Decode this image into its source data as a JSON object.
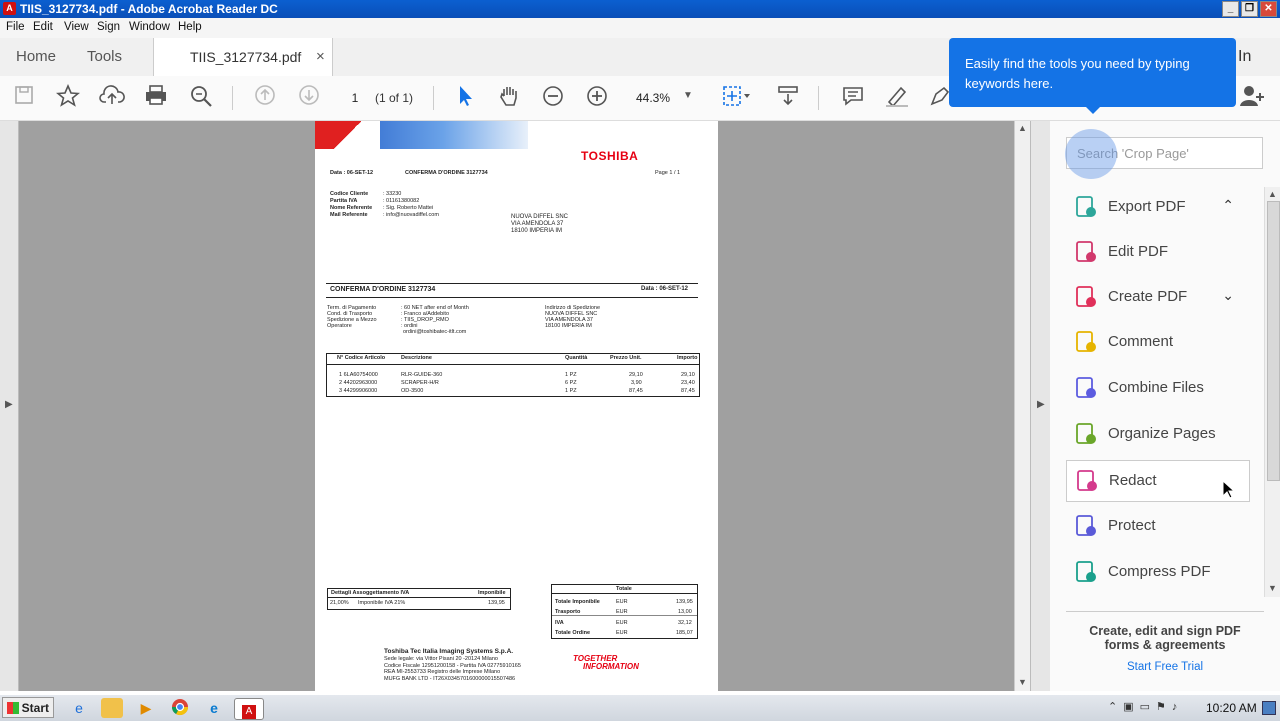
{
  "window": {
    "title": "TIIS_3127734.pdf - Adobe Acrobat Reader DC",
    "btn_min": "_",
    "btn_restore": "❐",
    "btn_close": "✕"
  },
  "menu": [
    "File",
    "Edit",
    "View",
    "Sign",
    "Window",
    "Help"
  ],
  "tabs": {
    "home": "Home",
    "tools": "Tools",
    "doc": "TIIS_3127734.pdf",
    "close": "×",
    "signin": "In"
  },
  "toolbar": {
    "page_value": "1",
    "page_of": "(1 of 1)",
    "zoom": "44.3%"
  },
  "callout": {
    "text": "Easily find the tools you need by typing keywords here."
  },
  "panel": {
    "search_placeholder": "Search 'Crop Page'",
    "tools": [
      {
        "label": "Export PDF",
        "icon": "export-pdf-icon",
        "color": "#2da69a",
        "chevron": "⌃"
      },
      {
        "label": "Edit PDF",
        "icon": "edit-pdf-icon",
        "color": "#d1386c",
        "chevron": ""
      },
      {
        "label": "Create PDF",
        "icon": "create-pdf-icon",
        "color": "#e0305a",
        "chevron": "⌄"
      },
      {
        "label": "Comment",
        "icon": "comment-icon",
        "color": "#e6b400",
        "chevron": ""
      },
      {
        "label": "Combine Files",
        "icon": "combine-files-icon",
        "color": "#5c5ce0",
        "chevron": ""
      },
      {
        "label": "Organize Pages",
        "icon": "organize-pages-icon",
        "color": "#6aa62a",
        "chevron": ""
      },
      {
        "label": "Redact",
        "icon": "redact-icon",
        "color": "#d43a8c",
        "chevron": ""
      },
      {
        "label": "Protect",
        "icon": "protect-icon",
        "color": "#5a5ad8",
        "chevron": ""
      },
      {
        "label": "Compress PDF",
        "icon": "compress-pdf-icon",
        "color": "#1aa08c",
        "chevron": ""
      }
    ],
    "promo_line1": "Create, edit and sign PDF",
    "promo_line2": "forms & agreements",
    "promo_link": "Start Free Trial"
  },
  "document": {
    "brand": "TOSHIBA",
    "date_small": "Data : 06-SET-12",
    "header_small": "CONFERMA D'ORDINE 3127734",
    "page_small": "Page  1 / 1",
    "client_labels": [
      "Codice Cliente",
      "Partita IVA",
      "Nome Referente",
      "Mail Referente"
    ],
    "client_values": [
      ": 33230",
      ": 01161380082",
      ": Sig. Roberto Mattei",
      ": info@nuovadiffel.com"
    ],
    "address": [
      "NUOVA DIFFEL SNC",
      "VIA AMENDOLA 37",
      "18100 IMPERIA IM"
    ],
    "title": "CONFERMA D'ORDINE 3127734",
    "title_date": "Data : 06-SET-12",
    "terms_labels": [
      "Term. di Pagamento",
      "Cond. di Trasporto",
      "Spedizione a Mezzo",
      "Operatore"
    ],
    "terms_values": [
      ": 60 NET after end of Month",
      ": Franco a/Addebito",
      ": TIIS_DROP_RMO",
      ": ordini"
    ],
    "operator_email": "ordini@toshibatec-itlt.com",
    "ship_label": "Indirizzo di Spedizione",
    "ship_address": [
      "NUOVA DIFFEL SNC",
      "VIA AMENDOLA 37",
      "18100 IMPERIA IM"
    ],
    "table_headers": [
      "N° Codice Articolo",
      "Descrizione",
      "Quantità",
      "Prezzo Unit.",
      "Importo"
    ],
    "rows": [
      [
        "1  6LA60754000",
        "RLR-GUIDE-360",
        "1 PZ",
        "29,10",
        "29,10"
      ],
      [
        "2  44202963000",
        "SCRAPER-H/R",
        "6 PZ",
        "3,90",
        "23,40"
      ],
      [
        "3  44299906000",
        "OD-3500",
        "1 PZ",
        "87,45",
        "87,45"
      ]
    ],
    "vat_headers": [
      "Dettagli Assoggettamento IVA",
      "Imponibile"
    ],
    "vat_row": [
      "21,00%",
      "Imponibile IVA 21%",
      "139,95"
    ],
    "totals_title": "Totale",
    "totals": [
      [
        "Totale Imponibile",
        "EUR",
        "139,95"
      ],
      [
        "Trasporto",
        "EUR",
        "13,00"
      ],
      [
        "IVA",
        "EUR",
        "32,12"
      ],
      [
        "Totale Ordine",
        "EUR",
        "185,07"
      ]
    ],
    "company": "Toshiba Tec Italia Imaging Systems S.p.A.",
    "company_lines": [
      "Sede legale: via Vittor Pisani 20 -20124 Milano",
      "Codice Fiscale 12951200158 - Partita IVA 02775910165",
      "REA MI-2553733 Registro delle Imprese Milano",
      "MUFG BANK LTD - IT26X0345701600000015507486"
    ],
    "slogan1": "TOGETHER",
    "slogan2": "INFORMATION"
  },
  "taskbar": {
    "start": "Start",
    "clock": "10:20 AM"
  }
}
